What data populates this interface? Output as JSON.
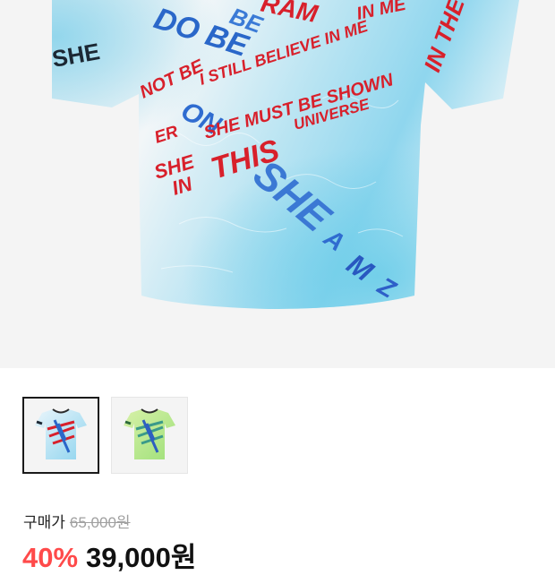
{
  "product": {
    "main_image": "graffiti-crop-tee-white-blue-red",
    "shirt_text": [
      "DO BE",
      "NOT BE",
      "I STILL BELIEVE IN ME",
      "BELIEVE IN ME",
      "SHE MUST BE SHOWN",
      "IN THIS UNIVERSE",
      "IN THE",
      "SHE"
    ],
    "thumbnails": [
      {
        "color_variant": "blue-red graffiti",
        "selected": true
      },
      {
        "color_variant": "green-blue graffiti",
        "selected": false
      }
    ]
  },
  "pricing": {
    "label": "구매가",
    "original_price": "65,000원",
    "discount": "40%",
    "sale_price": "39,000원"
  },
  "colors": {
    "discount": "#ff4a4a",
    "background": "#f4f4f4"
  }
}
